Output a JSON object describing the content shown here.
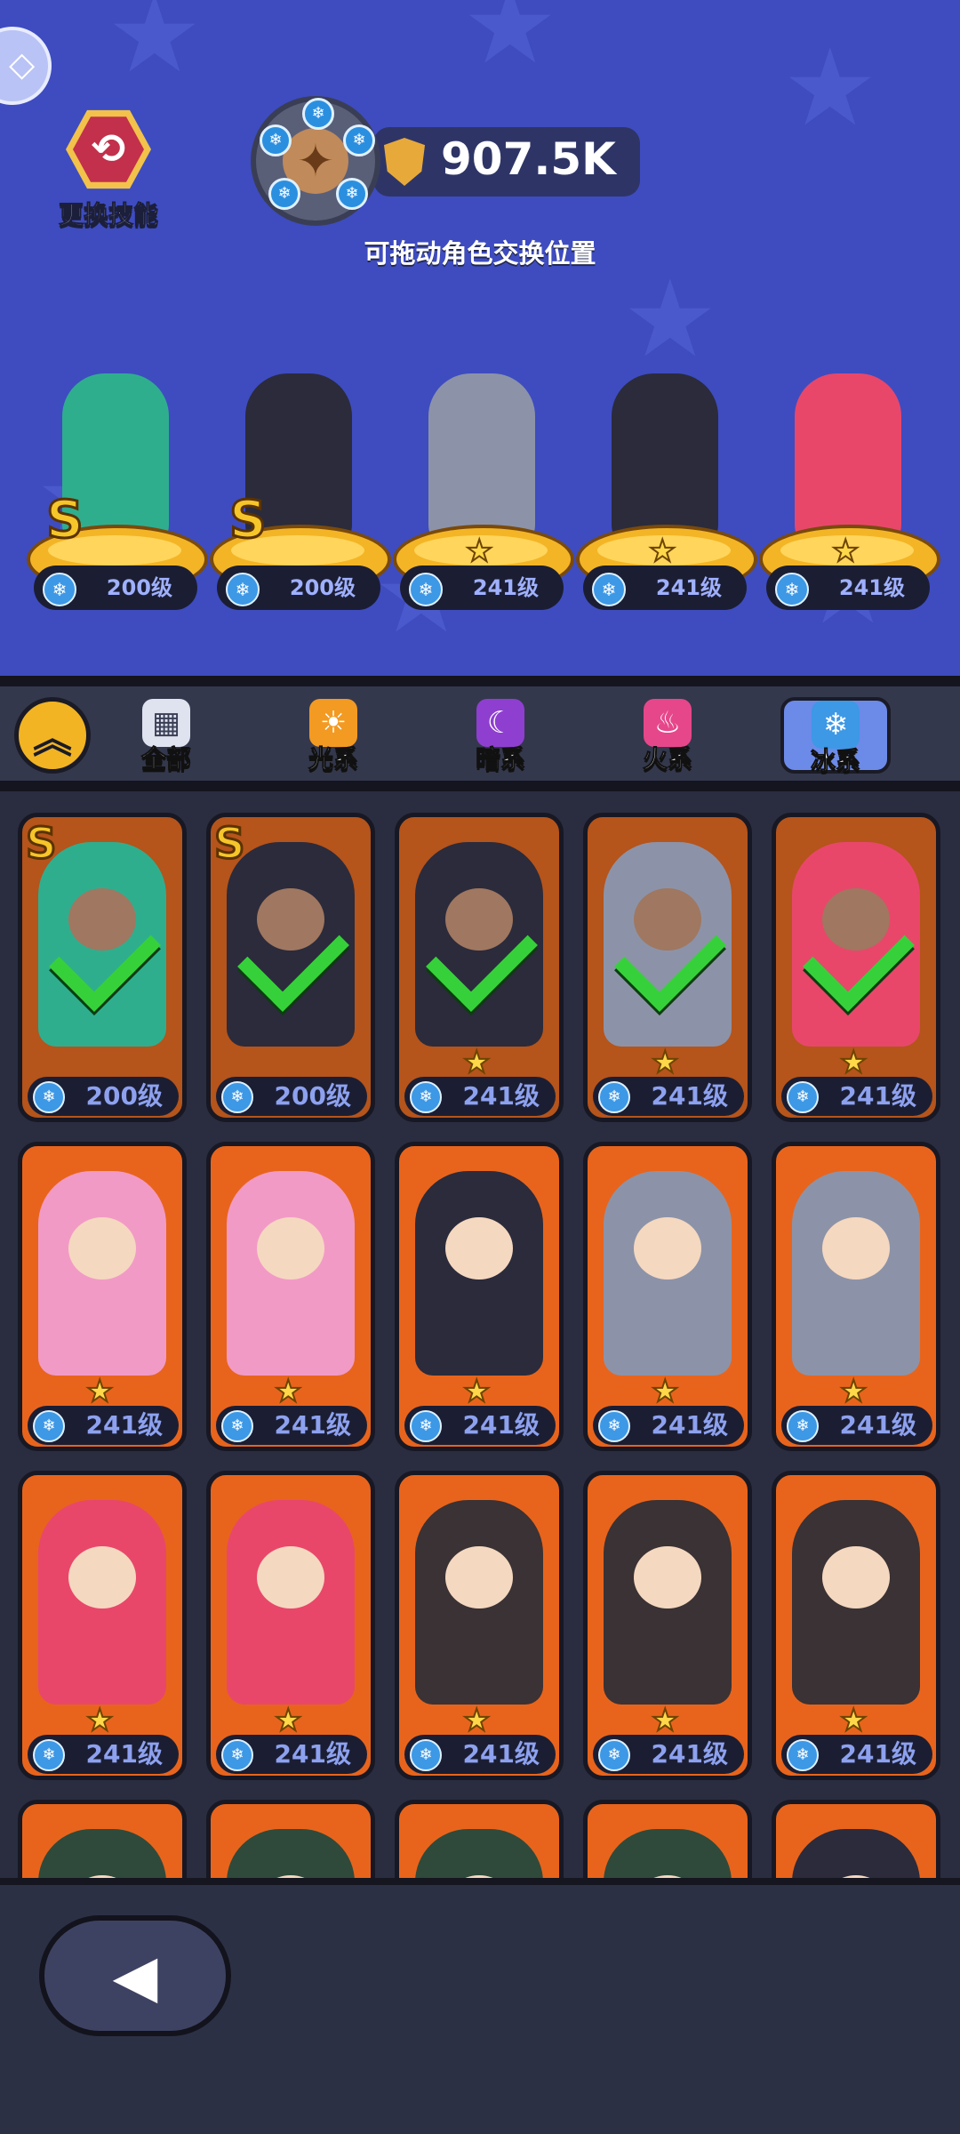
{
  "header": {
    "corner_icon": "arrow-icon",
    "skill_button": {
      "label": "更换技能",
      "icon": "swap-icon"
    },
    "power": {
      "value": "907.5K",
      "icon": "shield-icon"
    },
    "drag_hint": "可拖动角色交换位置"
  },
  "lineup": [
    {
      "level": "200级",
      "rank": "S",
      "stars": "",
      "character": "medusa",
      "color": "#2fae8e"
    },
    {
      "level": "200级",
      "rank": "S",
      "stars": "",
      "character": "snow-white",
      "color": "#2b2b3b"
    },
    {
      "level": "241级",
      "rank": "",
      "stars": "★",
      "character": "armored-knight",
      "color": "#8c93a8"
    },
    {
      "level": "241级",
      "rank": "",
      "stars": "★",
      "character": "spear-warrior",
      "color": "#2b2b3b"
    },
    {
      "level": "241级",
      "rank": "",
      "stars": "★",
      "character": "pink-mermaid",
      "color": "#e8476a"
    }
  ],
  "filters": {
    "collapse_icon": "chevron-up-icon",
    "tabs": [
      {
        "label": "全部",
        "icon": "grid-icon",
        "color": "#dfe3ef",
        "active": false
      },
      {
        "label": "光系",
        "icon": "light-icon",
        "color": "#f39a22",
        "active": false
      },
      {
        "label": "暗系",
        "icon": "dark-icon",
        "color": "#8e3fd0",
        "active": false
      },
      {
        "label": "火系",
        "icon": "fire-icon",
        "color": "#e6478a",
        "active": false
      },
      {
        "label": "冰系",
        "icon": "ice-icon",
        "color": "#3d98e6",
        "active": true
      }
    ]
  },
  "roster": [
    {
      "level": "200级",
      "rank": "S",
      "stars": "",
      "selected": true,
      "character": "medusa",
      "color": "#2fae8e"
    },
    {
      "level": "200级",
      "rank": "S",
      "stars": "",
      "selected": true,
      "character": "snow-white",
      "color": "#2b2b3b"
    },
    {
      "level": "241级",
      "rank": "",
      "stars": "★",
      "selected": true,
      "character": "spear-warrior",
      "color": "#2b2b3b"
    },
    {
      "level": "241级",
      "rank": "",
      "stars": "★",
      "selected": true,
      "character": "armored-knight",
      "color": "#8c93a8"
    },
    {
      "level": "241级",
      "rank": "",
      "stars": "★",
      "selected": true,
      "character": "pink-mermaid",
      "color": "#e8476a"
    },
    {
      "level": "241级",
      "rank": "",
      "stars": "★",
      "selected": false,
      "character": "ice-princess",
      "color": "#f29ac6"
    },
    {
      "level": "241级",
      "rank": "",
      "stars": "★",
      "selected": false,
      "character": "ice-princess",
      "color": "#f29ac6"
    },
    {
      "level": "241级",
      "rank": "",
      "stars": "★",
      "selected": false,
      "character": "spear-warrior",
      "color": "#2b2b3b"
    },
    {
      "level": "241级",
      "rank": "",
      "stars": "★",
      "selected": false,
      "character": "armored-knight",
      "color": "#8c93a8"
    },
    {
      "level": "241级",
      "rank": "",
      "stars": "★",
      "selected": false,
      "character": "armored-knight",
      "color": "#8c93a8"
    },
    {
      "level": "241级",
      "rank": "",
      "stars": "★",
      "selected": false,
      "character": "pink-mermaid",
      "color": "#e8476a"
    },
    {
      "level": "241级",
      "rank": "",
      "stars": "★",
      "selected": false,
      "character": "pink-mermaid",
      "color": "#e8476a"
    },
    {
      "level": "241级",
      "rank": "",
      "stars": "★",
      "selected": false,
      "character": "doll-girl",
      "color": "#3a3234"
    },
    {
      "level": "241级",
      "rank": "",
      "stars": "★",
      "selected": false,
      "character": "doll-girl",
      "color": "#3a3234"
    },
    {
      "level": "241级",
      "rank": "",
      "stars": "★",
      "selected": false,
      "character": "doll-girl",
      "color": "#3a3234"
    },
    {
      "level": "",
      "rank": "",
      "stars": "",
      "selected": false,
      "character": "partial",
      "color": "#2f4a3a"
    },
    {
      "level": "",
      "rank": "",
      "stars": "",
      "selected": false,
      "character": "partial",
      "color": "#2f4a3a"
    },
    {
      "level": "",
      "rank": "",
      "stars": "",
      "selected": false,
      "character": "partial",
      "color": "#2f4a3a"
    },
    {
      "level": "",
      "rank": "",
      "stars": "",
      "selected": false,
      "character": "partial",
      "color": "#2f4a3a"
    },
    {
      "level": "",
      "rank": "",
      "stars": "",
      "selected": false,
      "character": "partial",
      "color": "#2b2b3b"
    }
  ],
  "footer": {
    "back_icon": "back-icon"
  }
}
